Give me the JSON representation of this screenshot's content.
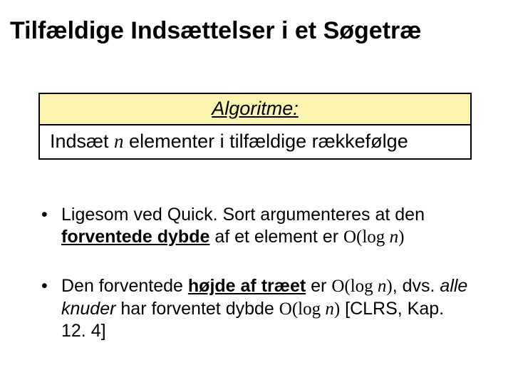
{
  "title": "Tilfældige Indsættelser i et Søgetræ",
  "box": {
    "header": "Algoritme:",
    "body_pre": "Indsæt ",
    "body_n": "n",
    "body_post": " elementer i tilfældige rækkefølge"
  },
  "bullet1": {
    "pre": "Ligesom ved Quick. Sort argumenteres at den ",
    "fd": "forventede dybde",
    "mid": " af et element er ",
    "ol": "O(log ",
    "n": "n",
    "cp": ")"
  },
  "bullet2": {
    "pre": "Den forventede ",
    "ht": "højde af træet",
    "mid1": " er ",
    "ol1": "O(log ",
    "n1": "n",
    "cp1": ")",
    "comma": ", dvs. ",
    "ak": "alle knuder",
    "mid2": " har forventet dybde ",
    "ol2": "O(log ",
    "n2": "n",
    "cp2": ")",
    "ref": " [CLRS, Kap. 12. 4]"
  }
}
